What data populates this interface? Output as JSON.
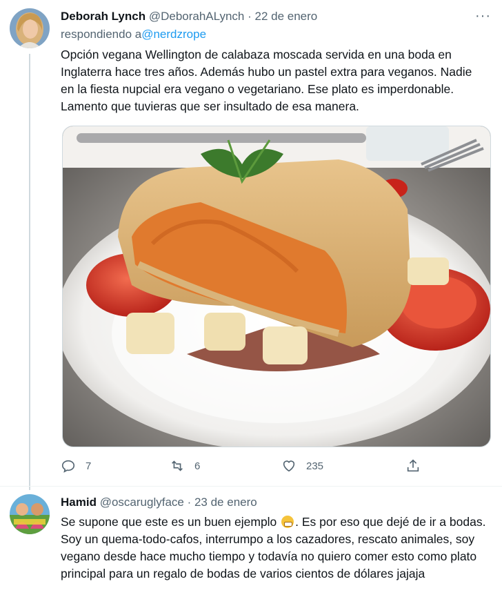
{
  "tweet1": {
    "author_name": "Deborah Lynch",
    "author_handle": "@DeborahALynch",
    "separator": " · ",
    "date": "22 de enero",
    "more_label": "···",
    "replying_prefix": "respondiendo a",
    "replying_handle": "@nerdzrope",
    "text": "Opción vegana Wellington de calabaza moscada servida en una boda en Inglaterra hace tres años. Además hubo un pastel extra para veganos. Nadie en la fiesta nupcial era vegano o vegetariano. Ese plato es imperdonable. Lamento que tuvieras que ser insultado de esa manera.",
    "image_alt": "Wellington vegano de calabaza con tomates y patatas",
    "actions": {
      "reply_count": "7",
      "retweet_count": "6",
      "like_count": "235"
    }
  },
  "tweet2": {
    "author_name": "Hamid",
    "author_handle": "@oscaruglyface",
    "separator": " · ",
    "date": "23 de enero",
    "text_before_emoji": "Se supone que este es un buen ejemplo ",
    "emoji": "grimacing-face",
    "text_after_emoji": ". Es por eso que dejé de ir a bodas. Soy un quema-todo-cafos, interrumpo a los cazadores, rescato animales, soy vegano desde hace mucho tiempo y todavía no quiero comer esto como plato principal para un regalo de bodas de varios cientos de dólares jajaja"
  },
  "colors": {
    "link": "#1d9bf0",
    "muted": "#536471",
    "text": "#0f1419",
    "thread_line": "#cfd9de"
  }
}
